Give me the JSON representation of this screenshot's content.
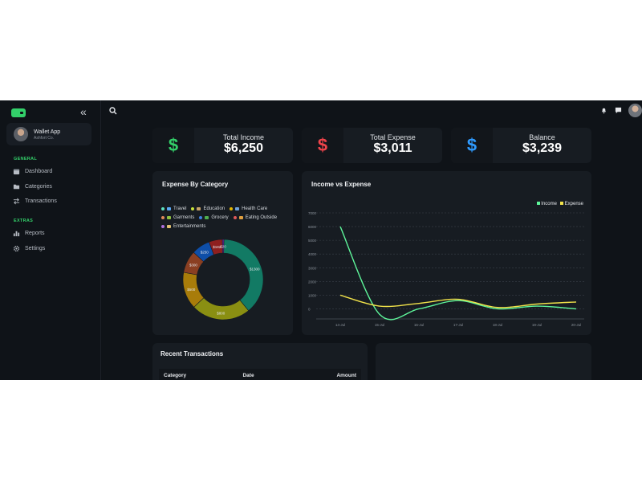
{
  "sidebar": {
    "user": {
      "name": "Wallet App",
      "subtitle": "Ashfort Co."
    },
    "sections": [
      {
        "title": "GENERAL",
        "items": [
          {
            "label": "Dashboard",
            "icon": "calendar-icon"
          },
          {
            "label": "Categories",
            "icon": "folder-icon"
          },
          {
            "label": "Transactions",
            "icon": "swap-icon"
          }
        ]
      },
      {
        "title": "EXTRAS",
        "items": [
          {
            "label": "Reports",
            "icon": "bar-chart-icon"
          },
          {
            "label": "Settings",
            "icon": "gear-icon"
          }
        ]
      }
    ]
  },
  "stats": [
    {
      "label": "Total Income",
      "value": "$6,250",
      "icon": "dollar-icon",
      "color": "#33d06a"
    },
    {
      "label": "Total Expense",
      "value": "$3,011",
      "icon": "dollar-icon",
      "color": "#f0444b"
    },
    {
      "label": "Balance",
      "value": "$3,239",
      "icon": "dollar-icon",
      "color": "#2f9bff"
    }
  ],
  "expense_by_category": {
    "title": "Expense By Category",
    "legend": [
      {
        "label": "Travel",
        "color": "#1f8f78",
        "emoji_color": "#5aa9f5"
      },
      {
        "label": "Education",
        "color": "#c8e23a",
        "emoji_color": "#c8a36a"
      },
      {
        "label": "Health Care",
        "color": "#e6b800",
        "emoji_color": "#6ea0d8"
      },
      {
        "label": "Garments",
        "color": "#e08a5a",
        "emoji_color": "#8fbf3f"
      },
      {
        "label": "Grocery",
        "color": "#3f7fe0",
        "emoji_color": "#4fae4f"
      },
      {
        "label": "Eating Outside",
        "color": "#e05a5a",
        "emoji_color": "#e0a040"
      },
      {
        "label": "Entertainments",
        "color": "#b070e0",
        "emoji_color": "#e0c070"
      }
    ]
  },
  "income_vs_expense": {
    "title": "Income vs Expense",
    "legend": [
      {
        "label": "Income",
        "color": "#5ef59a"
      },
      {
        "label": "Expense",
        "color": "#f2e34a"
      }
    ]
  },
  "recent_transactions": {
    "title": "Recent Transactions",
    "columns": [
      "Category",
      "Date",
      "Amount"
    ]
  },
  "chart_data": [
    {
      "type": "pie",
      "donut": true,
      "slices": [
        {
          "label": "Travel",
          "value": 1300,
          "data_label": "$1300",
          "color": "#127a64"
        },
        {
          "label": "Education",
          "value": 800,
          "data_label": "$800",
          "color": "#8a8f12"
        },
        {
          "label": "Health Care",
          "value": 500,
          "data_label": "$500",
          "color": "#a87c0a"
        },
        {
          "label": "Garments",
          "value": 300,
          "data_label": "$300",
          "color": "#8a3f22"
        },
        {
          "label": "Grocery",
          "value": 250,
          "data_label": "$250",
          "color": "#0e4ea8"
        },
        {
          "label": "Eating Outside",
          "value": 182,
          "data_label": "$182",
          "color": "#8e1f1f"
        },
        {
          "label": "Entertainments",
          "value": 20,
          "data_label": "$20",
          "color": "#6e2aa8"
        }
      ]
    },
    {
      "type": "line",
      "x": [
        "14-Jul",
        "15-Jul",
        "16-Jul",
        "17-Jul",
        "18-Jul",
        "19-Jul",
        "20-Jul"
      ],
      "ylim": [
        -500,
        7000
      ],
      "yticks": [
        0,
        1000,
        2000,
        3000,
        4000,
        5000,
        6000,
        7000
      ],
      "grid": true,
      "legend_position": "top-right",
      "series": [
        {
          "name": "Income",
          "color": "#5ef59a",
          "values": [
            6000,
            -400,
            0,
            600,
            0,
            200,
            0
          ]
        },
        {
          "name": "Expense",
          "color": "#f2e34a",
          "values": [
            1000,
            200,
            400,
            700,
            100,
            350,
            500
          ]
        }
      ]
    }
  ]
}
